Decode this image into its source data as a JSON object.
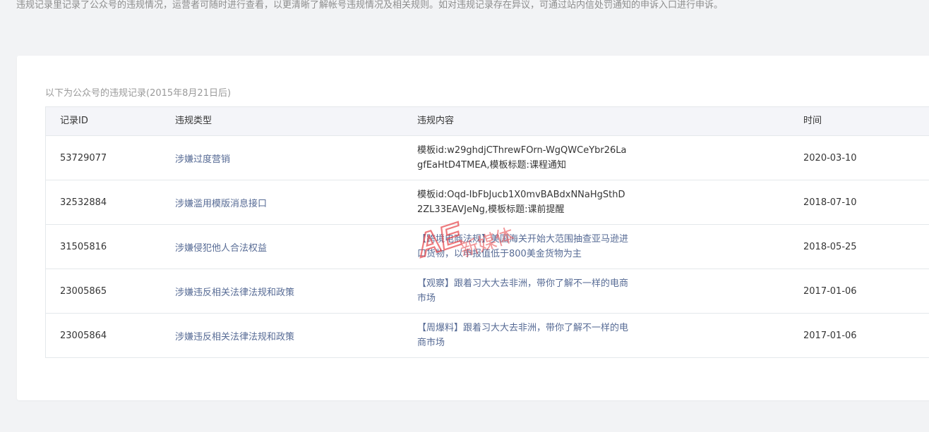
{
  "intro_text": "违规记录里记录了公众号的违规情况，运营者可随时进行查看，以更清晰了解帐号违规情况及相关规则。如对违规记录存在异议，可通过站内信处罚通知的申诉入口进行申诉。",
  "caption": "以下为公众号的违规记录(2015年8月21日后)",
  "table": {
    "headers": {
      "id": "记录ID",
      "type": "违规类型",
      "content": "违规内容",
      "time": "时间"
    },
    "rows": [
      {
        "id": "53729077",
        "type": "涉嫌过度营销",
        "content": "模板id:w29ghdjCThrewFOrn-WgQWCeYbr26LagfEaHtD4TMEA,模板标题:课程通知",
        "content_is_link": false,
        "time": "2020-03-10"
      },
      {
        "id": "32532884",
        "type": "涉嫌滥用模版消息接口",
        "content": "模板id:Oqd-IbFbJucb1X0mvBABdxNNaHgSthD2ZL33EAVJeNg,模板标题:课前提醒",
        "content_is_link": false,
        "time": "2018-07-10"
      },
      {
        "id": "31505816",
        "type": "涉嫌侵犯他人合法权益",
        "content": "【跨境电商法规】美国海关开始大范围抽查亚马逊进口货物，以申报值低于800美金货物为主",
        "content_is_link": true,
        "time": "2018-05-25"
      },
      {
        "id": "23005865",
        "type": "涉嫌违反相关法律法规和政策",
        "content": "【观察】跟着习大大去非洲，带你了解不一样的电商市场",
        "content_is_link": true,
        "time": "2017-01-06"
      },
      {
        "id": "23005864",
        "type": "涉嫌违反相关法律法规和政策",
        "content": "【周爆料】跟着习大大去非洲，带你了解不一样的电商市场",
        "content_is_link": true,
        "time": "2017-01-06"
      }
    ]
  },
  "watermark": {
    "text_main": "AE",
    "text_sub": "新媒体",
    "color": "#e8474c"
  },
  "colors": {
    "link": "#576b95",
    "text": "#353535",
    "muted": "#8d8d8d"
  }
}
